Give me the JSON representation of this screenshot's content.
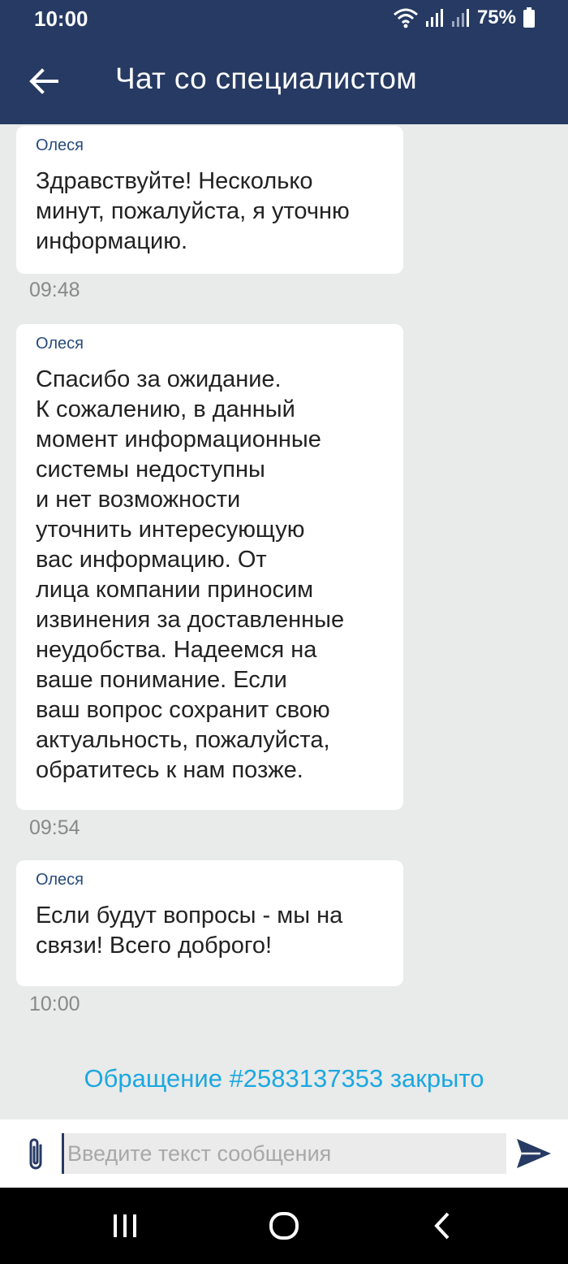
{
  "status_bar": {
    "time": "10:00",
    "battery": "75%",
    "icons": [
      "wifi-icon",
      "signal-icon",
      "signal-icon",
      "battery-icon"
    ]
  },
  "header": {
    "title": "Чат со специалистом",
    "back_icon": "arrow-left-icon"
  },
  "messages": [
    {
      "sender": "Олеся",
      "text": "Здравствуйте! Несколько\nминут, пожалуйста, я уточню\nинформацию.",
      "time": "09:48"
    },
    {
      "sender": "Олеся",
      "text": "Спасибо за ожидание.\nК сожалению, в данный\nмомент информационные\nсистемы недоступны\nи нет возможности\nуточнить интересующую\nвас информацию. От\nлица компании приносим\nизвинения за доставленные\nнеудобства. Надеемся на\nваше понимание. Если\nваш вопрос сохранит свою\nактуальность, пожалуйста,\nобратитесь к нам позже.",
      "time": "09:54"
    },
    {
      "sender": "Олеся",
      "text": "Если будут вопросы - мы на\nсвязи! Всего доброго!",
      "time": "10:00"
    }
  ],
  "closed_notice": "Обращение #2583137353 закрыто",
  "composer": {
    "placeholder": "Введите текст сообщения",
    "value": "",
    "attach_icon": "paperclip-icon",
    "send_icon": "send-icon"
  },
  "nav_bar": {
    "icons": [
      "recent-apps-icon",
      "home-icon",
      "back-icon"
    ]
  },
  "colors": {
    "header_bg": "#263a63",
    "accent": "#1ba8e0",
    "chat_bg": "#e9eaea"
  }
}
